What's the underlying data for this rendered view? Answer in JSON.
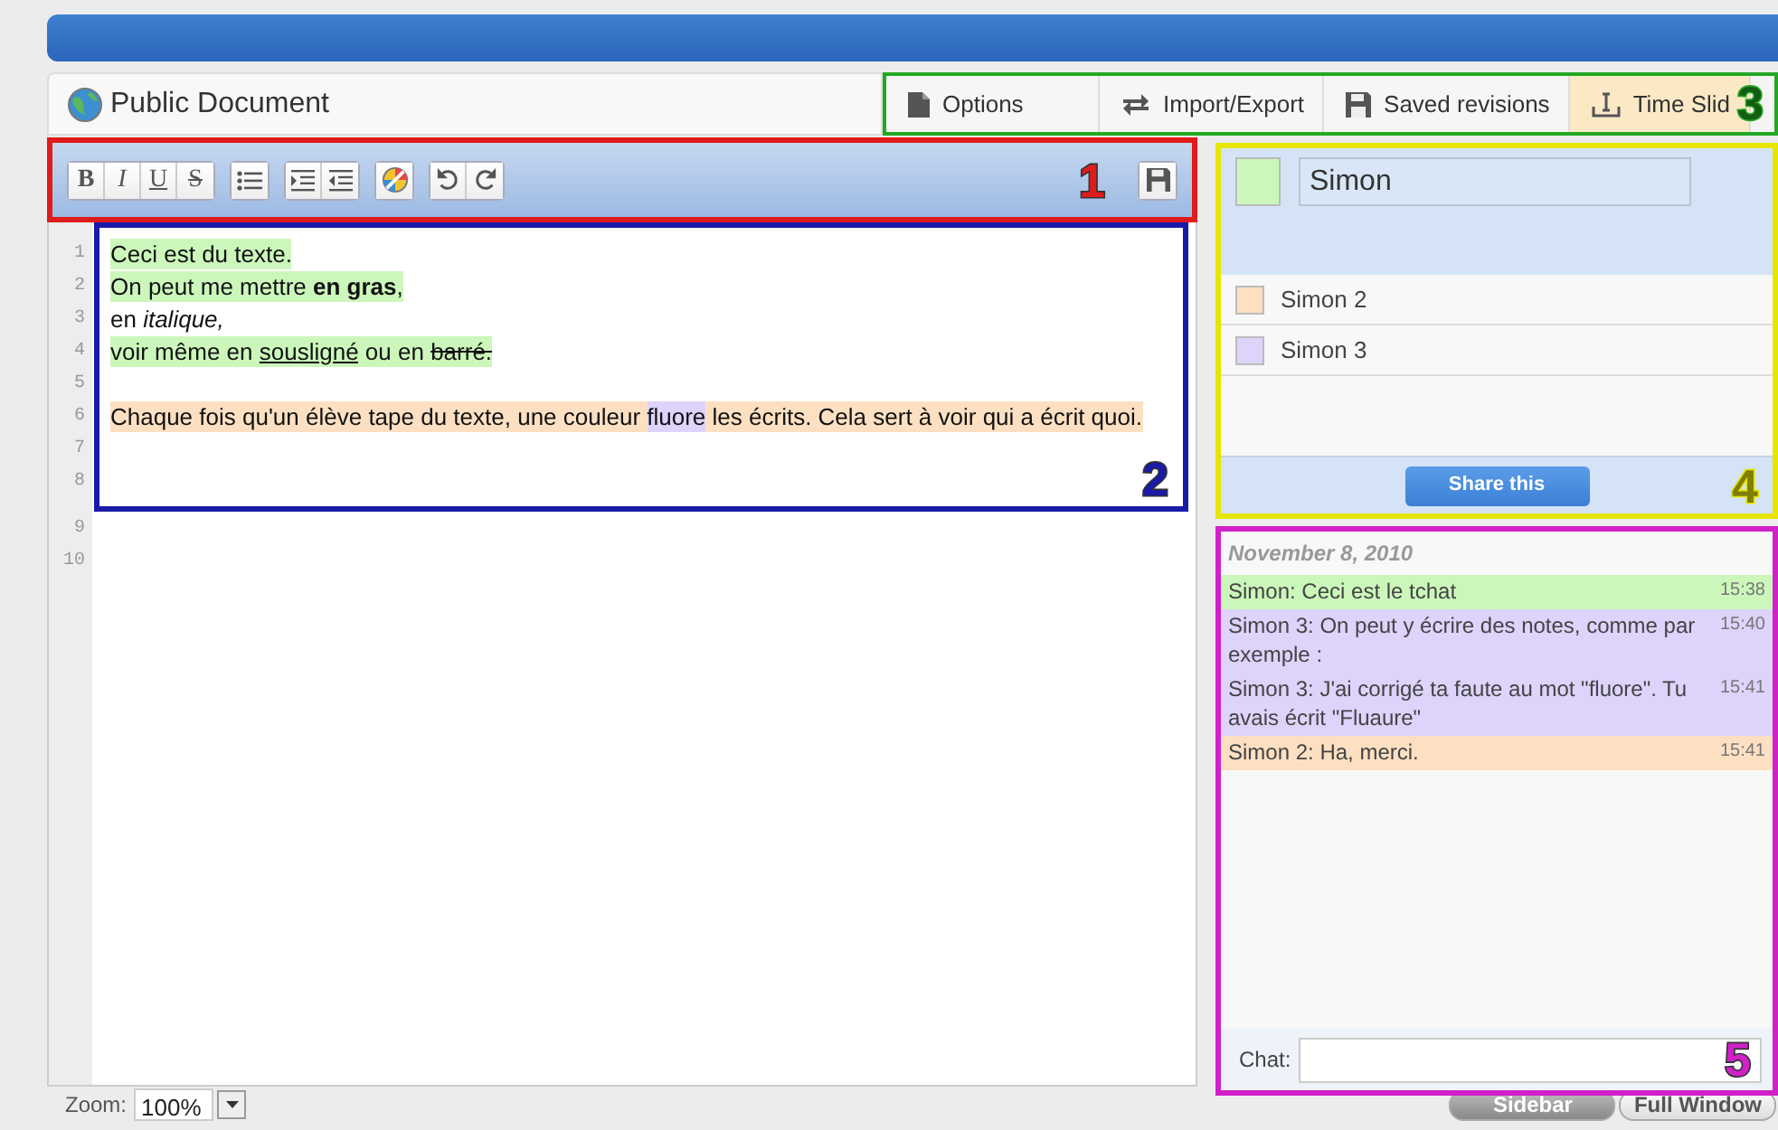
{
  "document": {
    "title": "Public Document"
  },
  "tabs": [
    {
      "label": "Options",
      "kind": "options",
      "selected": false
    },
    {
      "label": "Import/Export",
      "kind": "import-export",
      "selected": false
    },
    {
      "label": "Saved revisions",
      "kind": "revisions",
      "selected": false
    },
    {
      "label": "Time Slid",
      "kind": "time-slider",
      "selected": true
    }
  ],
  "toolbar": {
    "groups": [
      [
        {
          "kind": "bold",
          "label": "B"
        },
        {
          "kind": "italic",
          "label": "I"
        },
        {
          "kind": "underline",
          "label": "U"
        },
        {
          "kind": "strike",
          "label": "S"
        }
      ],
      [
        {
          "kind": "bullet-list"
        }
      ],
      [
        {
          "kind": "indent"
        },
        {
          "kind": "outdent"
        }
      ],
      [
        {
          "kind": "color"
        }
      ],
      [
        {
          "kind": "undo"
        },
        {
          "kind": "redo"
        }
      ]
    ],
    "save": {
      "kind": "save"
    }
  },
  "editor": {
    "lines": [
      {
        "number": "1",
        "segments": [
          {
            "text": "Ceci est du texte.",
            "color": "#ccf7bb",
            "kind": "plain"
          }
        ]
      },
      {
        "number": "2",
        "segments": [
          {
            "text": "On peut me mettre ",
            "color": "#ccf7bb",
            "kind": "plain"
          },
          {
            "text": "en gras",
            "color": "#ccf7bb",
            "kind": "bold"
          },
          {
            "text": ",",
            "color": "#ccf7bb",
            "kind": "plain"
          }
        ]
      },
      {
        "number": "3",
        "segments": [
          {
            "text": "en ",
            "kind": "plain"
          },
          {
            "text": "italique,",
            "kind": "italic"
          }
        ]
      },
      {
        "number": "4",
        "segments": [
          {
            "text": "voir même en ",
            "color": "#ccf7bb",
            "kind": "plain"
          },
          {
            "text": "sousligné",
            "color": "#ccf7bb",
            "kind": "underline"
          },
          {
            "text": " ou en ",
            "color": "#ccf7bb",
            "kind": "plain"
          },
          {
            "text": "barré.",
            "color": "#ccf7bb",
            "kind": "strike"
          }
        ]
      },
      {
        "number": "5"
      },
      {
        "number": "6",
        "segments": [
          {
            "text": "Chaque fois qu'un élève tape du texte, une couleur ",
            "color": "#fde0c2",
            "kind": "plain"
          },
          {
            "text": "fluore",
            "color": "#ddd3fb",
            "kind": "plain"
          },
          {
            "text": " les écrits. Cela sert à voir qui a écrit quoi.",
            "color": "#fde0c2",
            "kind": "plain"
          }
        ]
      },
      {
        "number": "7"
      },
      {
        "number": "8"
      }
    ],
    "more_lines": [
      {
        "number": "9"
      },
      {
        "number": "10"
      }
    ]
  },
  "users": {
    "me": {
      "name": "Simon",
      "color": "#ccf7bb"
    },
    "others": [
      {
        "name": "Simon 2",
        "color": "#fde0c2"
      },
      {
        "name": "Simon 3",
        "color": "#ddd3fb"
      }
    ],
    "share_button": "Share this"
  },
  "chat": {
    "date": "November 8, 2010",
    "messages": [
      {
        "text": "Simon: Ceci est le tchat",
        "time": "15:38",
        "color": "#ccf7bb"
      },
      {
        "text": "Simon 3: On peut y écrire des notes, comme par exemple :",
        "time": "15:40",
        "color": "#ddd3fb"
      },
      {
        "text": "Simon 3: J'ai corrigé ta faute au mot \"fluore\". Tu avais écrit \"Fluaure\"",
        "time": "15:41",
        "color": "#ddd3fb"
      },
      {
        "text": "Simon 2: Ha, merci.",
        "time": "15:41",
        "color": "#fde0c2"
      }
    ],
    "input_label": "Chat:"
  },
  "footer": {
    "zoom_label": "Zoom:",
    "zoom_value": "100%",
    "view_buttons": [
      {
        "label": "Sidebar",
        "selected": true
      },
      {
        "label": "Full Window",
        "selected": false
      }
    ]
  },
  "annotations": [
    {
      "label": "1",
      "color": "#e01b1b"
    },
    {
      "label": "2",
      "color": "#1a1aa8"
    },
    {
      "label": "3",
      "color": "#22a822"
    },
    {
      "label": "4",
      "color": "#e6e600"
    },
    {
      "label": "5",
      "color": "#d020c8"
    }
  ]
}
